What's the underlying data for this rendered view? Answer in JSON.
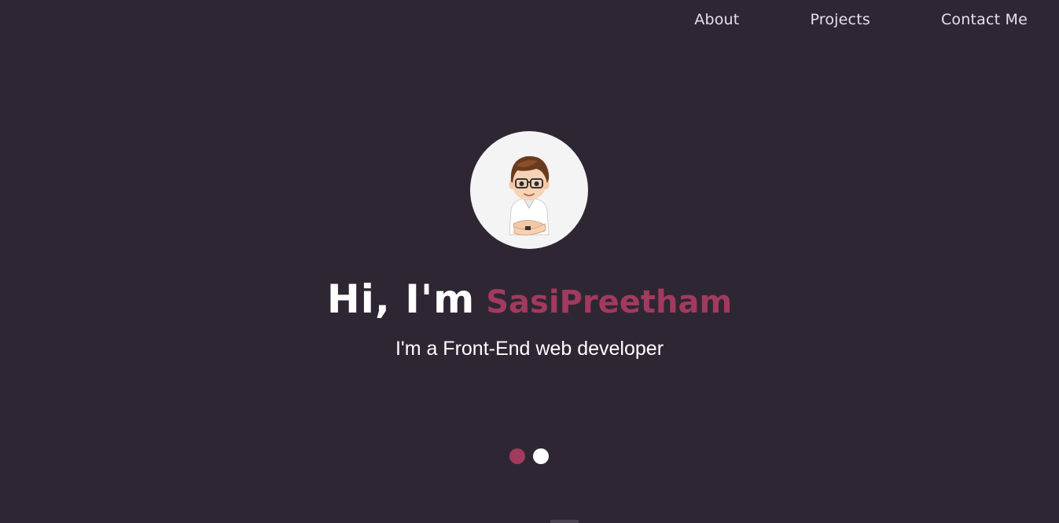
{
  "nav": {
    "items": [
      {
        "label": "About"
      },
      {
        "label": "Projects"
      },
      {
        "label": "Contact Me"
      }
    ]
  },
  "hero": {
    "avatar_icon": "cartoon-avatar-icon",
    "greeting": "Hi, I'm",
    "name": "SasiPreetham",
    "subtitle": "I'm a Front-End web developer"
  },
  "carousel": {
    "dots": [
      {
        "state": "active"
      },
      {
        "state": "inactive"
      }
    ]
  },
  "colors": {
    "background": "#2e2733",
    "accent": "#a13a5e",
    "text": "#ffffff"
  }
}
